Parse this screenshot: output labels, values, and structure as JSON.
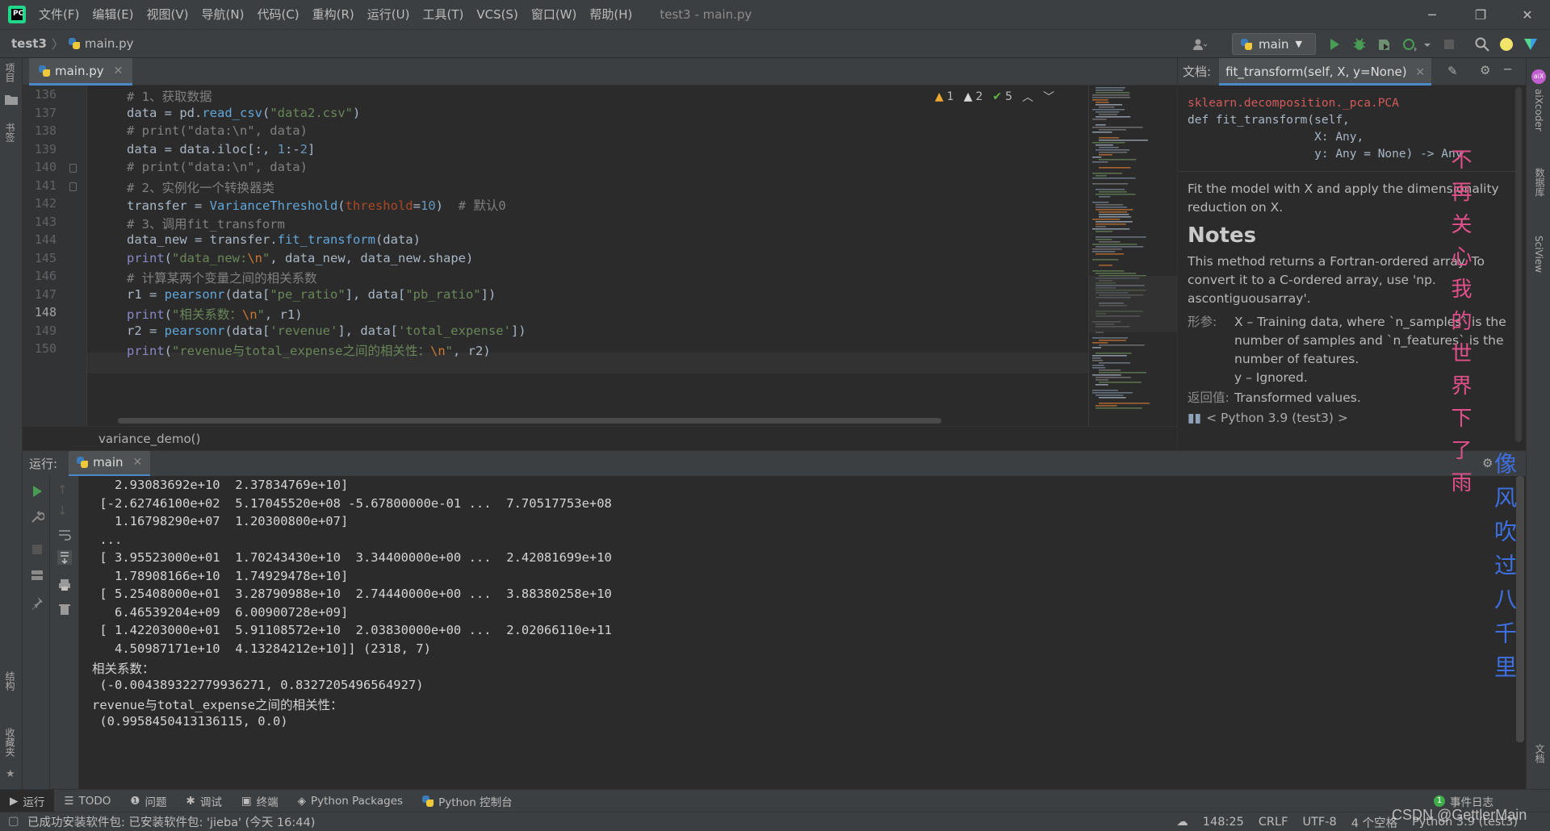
{
  "app": {
    "menu": [
      "文件(F)",
      "编辑(E)",
      "视图(V)",
      "导航(N)",
      "代码(C)",
      "重构(R)",
      "运行(U)",
      "工具(T)",
      "VCS(S)",
      "窗口(W)",
      "帮助(H)"
    ],
    "window_title": "test3 - main.py"
  },
  "nav": {
    "project": "test3",
    "file": "main.py",
    "run_config": "main"
  },
  "left_stripe": {
    "project": "项目",
    "bookmarks": "书签",
    "structure": "结构",
    "favorites": "收藏夹"
  },
  "right_stripe": {
    "aixcoder": "aiXcoder",
    "database": "数据库",
    "sciview": "SciView",
    "docs": "文档"
  },
  "editor": {
    "tab": "main.py",
    "inspections": {
      "warn1": "1",
      "warn2": "2",
      "ok": "5"
    },
    "breadcrumb": "variance_demo()",
    "lines": [
      {
        "n": "136",
        "code": "# 1、获取数据"
      },
      {
        "n": "137",
        "code": "data = pd.read_csv(\"data2.csv\")"
      },
      {
        "n": "138",
        "code": "# print(\"data:\\n\", data)"
      },
      {
        "n": "139",
        "code": "data = data.iloc[:, 1:-2]"
      },
      {
        "n": "140",
        "code": "# print(\"data:\\n\", data)"
      },
      {
        "n": "141",
        "code": "# 2、实例化一个转换器类"
      },
      {
        "n": "142",
        "code": "transfer = VarianceThreshold(threshold=10)  # 默认0"
      },
      {
        "n": "143",
        "code": "# 3、调用fit_transform"
      },
      {
        "n": "144",
        "code": "data_new = transfer.fit_transform(data)"
      },
      {
        "n": "145",
        "code": "print(\"data_new:\\n\", data_new, data_new.shape)"
      },
      {
        "n": "146",
        "code": "# 计算某两个变量之间的相关系数"
      },
      {
        "n": "147",
        "code": "r1 = pearsonr(data[\"pe_ratio\"], data[\"pb_ratio\"])"
      },
      {
        "n": "148",
        "code": "print(\"相关系数：\\n\", r1)"
      },
      {
        "n": "149",
        "code": "r2 = pearsonr(data['revenue'], data['total_expense'])"
      },
      {
        "n": "150",
        "code": "print(\"revenue与total_expense之间的相关性：\\n\", r2)"
      }
    ]
  },
  "doc": {
    "label": "文档:",
    "tab": "fit_transform(self, X, y=None)",
    "module": "sklearn.decomposition._pca.PCA",
    "sig1": "def fit_transform(self,",
    "sig2": "                  X: Any,",
    "sig3": "                  y: Any = None) -> Any",
    "summary": "Fit the model with X and apply the dimensionality reduction on X.",
    "notes_heading": "Notes",
    "notes": "This method returns a Fortran-ordered array. To convert it to a C-ordered array, use 'np. ascontiguousarray'.",
    "params_label": "形参:",
    "param_x": "X – Training data, where `n_samples` is the number of samples and `n_features` is the number of features.",
    "param_y": "y – Ignored.",
    "returns_label": "返回值:",
    "returns": "Transformed values.",
    "interpreter": "< Python 3.9 (test3) >"
  },
  "run": {
    "title": "运行:",
    "tab": "main",
    "output": [
      "   2.93083692e+10  2.37834769e+10]",
      " [-2.62746100e+02  5.17045520e+08 -5.67800000e-01 ...  7.70517753e+08",
      "   1.16798290e+07  1.20300800e+07]",
      " ...",
      " [ 3.95523000e+01  1.70243430e+10  3.34400000e+00 ...  2.42081699e+10",
      "   1.78908166e+10  1.74929478e+10]",
      " [ 5.25408000e+01  3.28790988e+10  2.74440000e+00 ...  3.88380258e+10",
      "   6.46539204e+09  6.00900728e+09]",
      " [ 1.42203000e+01  5.91108572e+10  2.03830000e+00 ...  2.02066110e+11",
      "   4.50987171e+10  4.13284212e+10]] (2318, 7)",
      "相关系数：",
      " (-0.004389322779936271, 0.8327205496564927)",
      "revenue与total_expense之间的相关性：",
      " (0.9958450413136115, 0.0)"
    ]
  },
  "tool_windows": [
    "运行",
    "TODO",
    "问题",
    "调试",
    "终端",
    "Python Packages",
    "Python 控制台"
  ],
  "event_log": "事件日志",
  "status": {
    "message": "已成功安装软件包: 已安装软件包: 'jieba' (今天 16:44)",
    "position": "148:25",
    "line_sep": "CRLF",
    "encoding": "UTF-8",
    "indent": "4 个空格",
    "interpreter": "Python 3.9 (test3)"
  },
  "overlay": {
    "line1": "不再关心我的世界下了雨",
    "line2": "像风吹过八千里",
    "watermark": "CSDN @GettlerMain"
  },
  "colors": {
    "accent": "#4a88c7",
    "run_green": "#499c54",
    "warning": "#f0a732"
  }
}
